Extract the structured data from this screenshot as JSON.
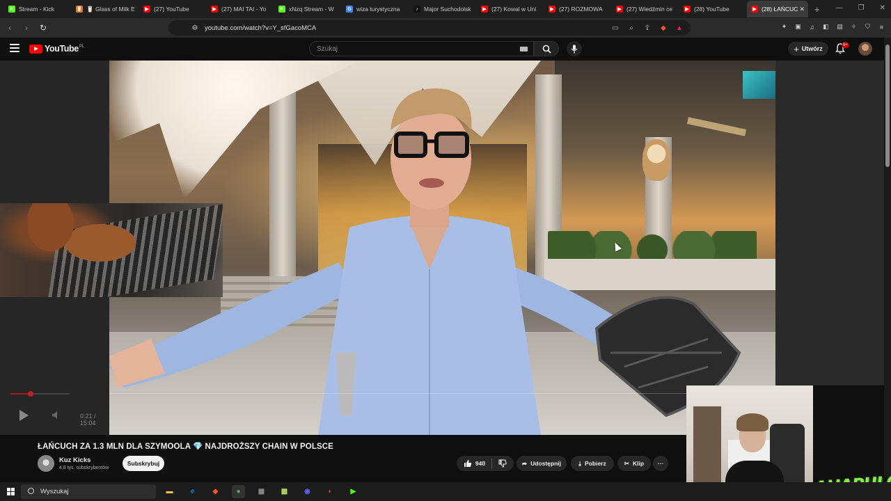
{
  "browser": {
    "tabs": [
      {
        "label": "Stream - Kick",
        "fav_color": "#53fc18",
        "fav_glyph": "K"
      },
      {
        "label": "🥛 Glass of Milk E",
        "fav_color": "#e0762b",
        "fav_glyph": "🥛"
      },
      {
        "label": "(27) YouTube",
        "fav_color": "#ff0000",
        "fav_glyph": "▶"
      },
      {
        "label": "(27) MAI TAI - Yo",
        "fav_color": "#ff0000",
        "fav_glyph": "▶"
      },
      {
        "label": "xNzq Stream - W",
        "fav_color": "#53fc18",
        "fav_glyph": "K"
      },
      {
        "label": "wiza turystyczna",
        "fav_color": "#4285f4",
        "fav_glyph": "G"
      },
      {
        "label": "Major Suchodolsk",
        "fav_color": "#111111",
        "fav_glyph": "♪"
      },
      {
        "label": "(27) Kowal w Uni",
        "fav_color": "#ff0000",
        "fav_glyph": "▶"
      },
      {
        "label": "(27) ROZMOWA",
        "fav_color": "#ff0000",
        "fav_glyph": "▶"
      },
      {
        "label": "(27) Wiedźmin ce",
        "fav_color": "#ff0000",
        "fav_glyph": "▶"
      },
      {
        "label": "(28) YouTube",
        "fav_color": "#ff0000",
        "fav_glyph": "▶"
      },
      {
        "label": "(28) ŁAŃCUC",
        "fav_color": "#ff0000",
        "fav_glyph": "▶",
        "active": true
      }
    ],
    "new_tab": "+",
    "url": "youtube.com/watch?v=Y_sfGacoMCA"
  },
  "youtube": {
    "logo_text": "YouTube",
    "region": "PL",
    "search_placeholder": "Szukaj",
    "create_label": "Utwórz",
    "notif_badge": "9+"
  },
  "player": {
    "time": "0:21 / 15:04",
    "progress_fraction": 0.023
  },
  "video": {
    "title": "ŁAŃCUCH ZA 1.3 MLN DLA SZYMOOLA",
    "title_suffix": "NAJDROŻSZY CHAIN W POLSCE",
    "gem": "💎",
    "channel": "Kuz Kicks",
    "subscribers": "4,8 tys. subskrybentów",
    "subscribe_label": "Subskrybuj",
    "likes": "940",
    "share_label": "Udostępnij",
    "download_label": "Pobierz",
    "clip_label": "Klip",
    "more": "···"
  },
  "overlay": {
    "brand": "AHAPULCO"
  },
  "taskbar": {
    "search_label": "Wyszukaj",
    "apps": [
      "file-explorer",
      "edge",
      "brave",
      "chrome",
      "app-5",
      "app-6",
      "app-7",
      "app-8",
      "app-9"
    ]
  }
}
